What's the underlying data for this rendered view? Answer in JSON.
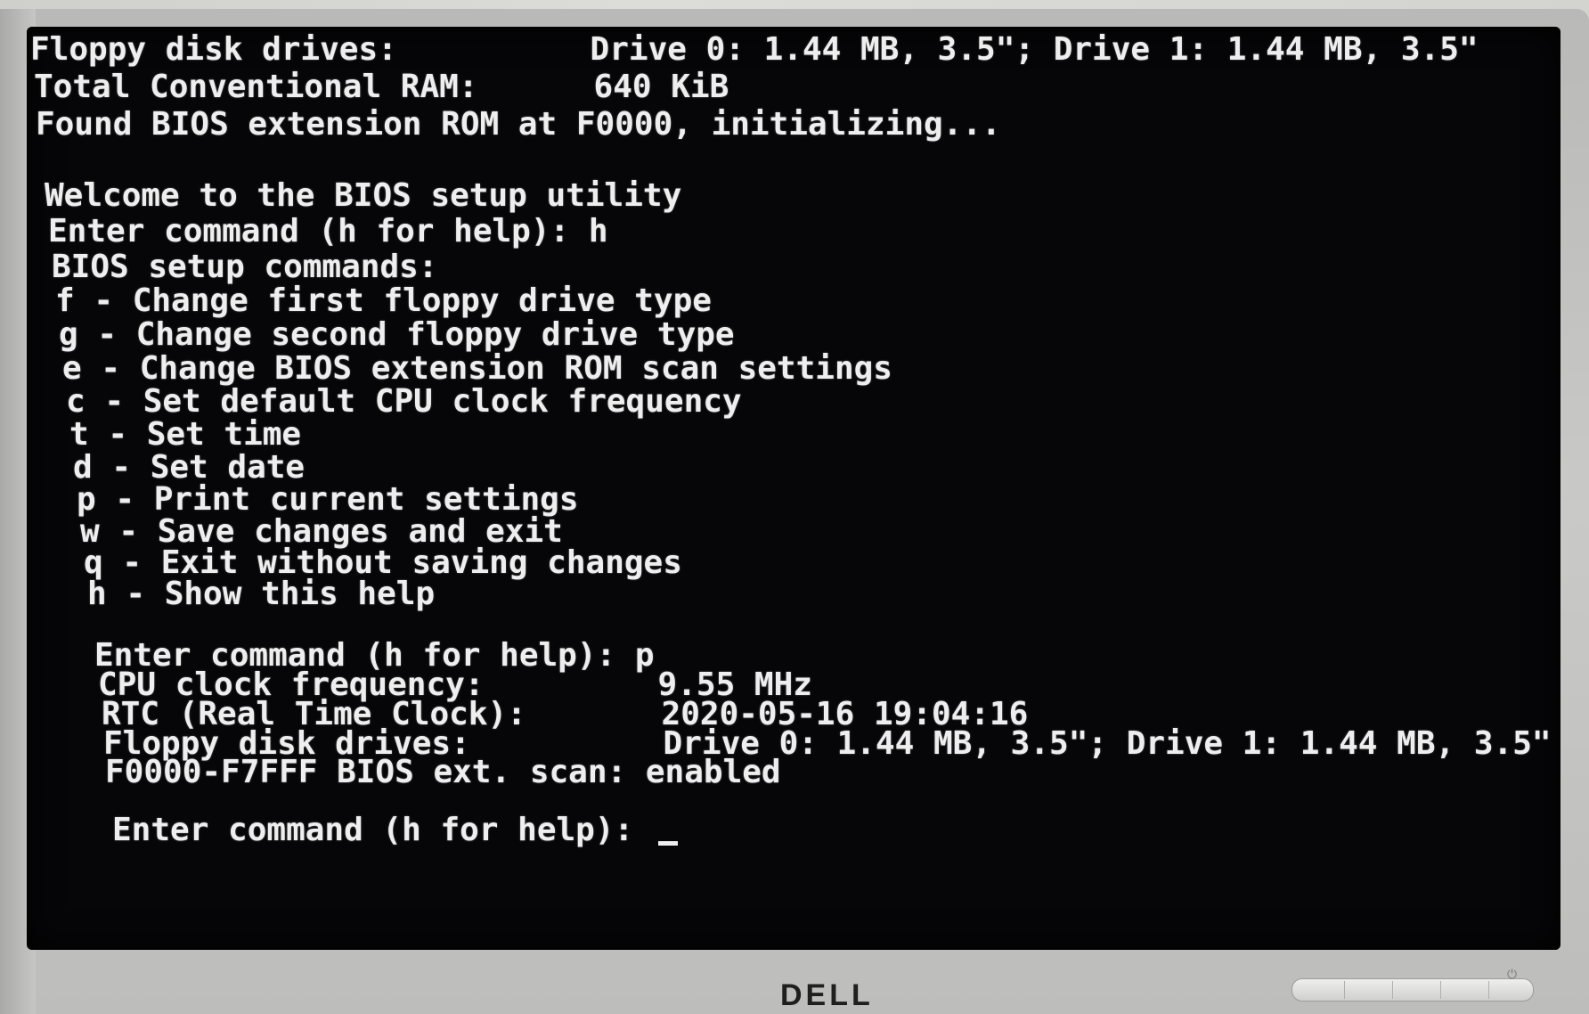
{
  "monitor": {
    "brand": "DELL",
    "buttons": [
      "menu",
      "input",
      "minus",
      "plus",
      "power"
    ]
  },
  "console": {
    "lines": [
      "Floppy disk drives:          Drive 0: 1.44 MB, 3.5\"; Drive 1: 1.44 MB, 3.5\"",
      "Total Conventional RAM:      640 KiB",
      "Found BIOS extension ROM at F0000, initializing...",
      "",
      "Welcome to the BIOS setup utility",
      "Enter command (h for help): h",
      "BIOS setup commands:",
      "f - Change first floppy drive type",
      "g - Change second floppy drive type",
      "e - Change BIOS extension ROM scan settings",
      "c - Set default CPU clock frequency",
      "t - Set time",
      "d - Set date",
      "p - Print current settings",
      "w - Save changes and exit",
      "q - Exit without saving changes",
      "h - Show this help",
      "",
      "Enter command (h for help): p",
      "CPU clock frequency:         9.55 MHz",
      "RTC (Real Time Clock):       2020-05-16 19:04:16",
      "Floppy disk drives:          Drive 0: 1.44 MB, 3.5\"; Drive 1: 1.44 MB, 3.5\"",
      "F0000-F7FFF BIOS ext. scan: enabled",
      "",
      "Enter command (h for help): "
    ]
  }
}
